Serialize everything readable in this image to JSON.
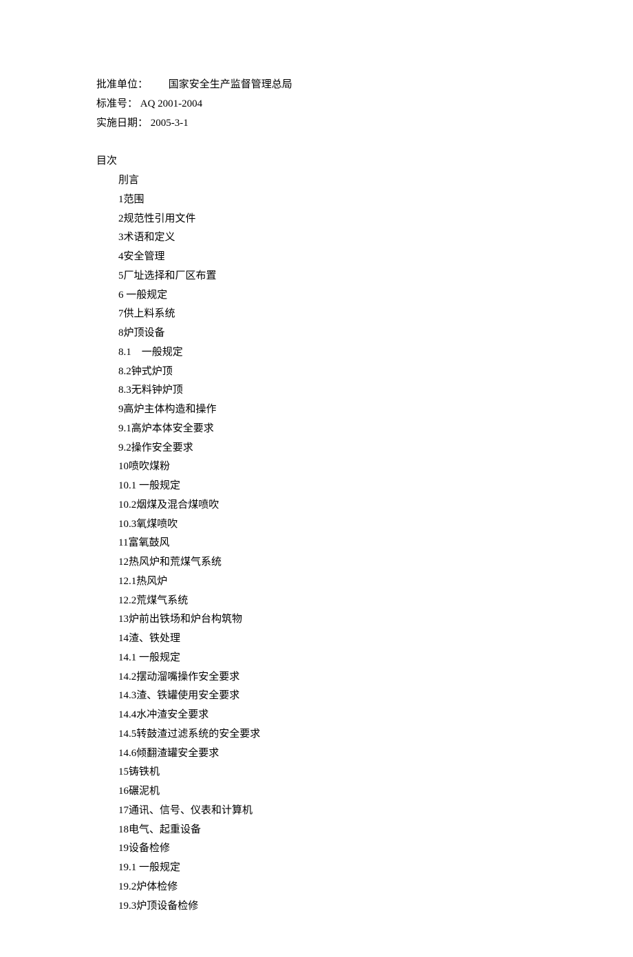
{
  "meta": {
    "approver_label": "批准单位：",
    "approver_value": "国家安全生产监督管理总局",
    "std_label": "标准号：",
    "std_value": "AQ 2001-2004",
    "date_label": "实施日期：",
    "date_value": "2005-3-1"
  },
  "toc_header": "目次",
  "toc": [
    "刖言",
    "1范围",
    "2规范性引用文件",
    "3术语和定义",
    "4安全管理",
    "5厂址选择和厂区布置",
    "6 一般规定",
    "7供上料系统",
    "8炉顶设备",
    "8.1　一般规定",
    "8.2钟式炉顶",
    "8.3无料钟炉顶",
    "9高炉主体构造和操作",
    "9.1高炉本体安全要求",
    "9.2操作安全要求",
    "10喷吹煤粉",
    "10.1 一般规定",
    "10.2烟煤及混合煤喷吹",
    "10.3氧煤喷吹",
    "11富氧鼓风",
    "12热风炉和荒煤气系统",
    "12.1热风炉",
    "12.2荒煤气系统",
    "13炉前出铁场和炉台构筑物",
    "14渣、铁处理",
    "14.1 一般规定",
    "14.2摆动溜嘴操作安全要求",
    "14.3渣、铁罐使用安全要求",
    "14.4水冲渣安全要求",
    "14.5转鼓渣过滤系统的安全要求",
    "14.6倾翻渣罐安全要求",
    "15铸铁机",
    "16碾泥机",
    "17通讯、信号、仪表和计算机",
    "18电气、起重设备",
    "19设备检修",
    "19.1 一般规定",
    "19.2炉体检修",
    "19.3炉顶设备检修"
  ]
}
